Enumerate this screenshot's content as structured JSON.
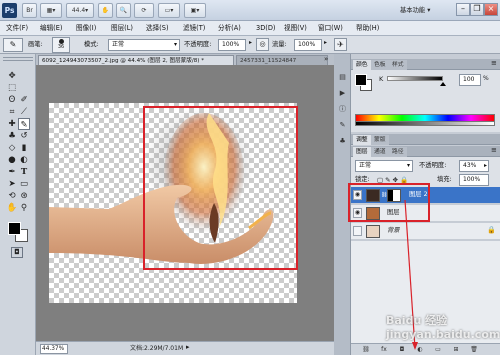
{
  "titlebar": {
    "logo": "Ps",
    "zoom_value": "44.4",
    "workspace": "基本功能",
    "workspace_arrow": "▾"
  },
  "menu": [
    "文件(F)",
    "编辑(E)",
    "图像(I)",
    "图层(L)",
    "选择(S)",
    "滤镜(T)",
    "分析(A)",
    "3D(D)",
    "视图(V)",
    "窗口(W)",
    "帮助(H)"
  ],
  "options": {
    "brush_label": "画笔:",
    "brush_size": "36",
    "mode_label": "模式:",
    "mode_value": "正常",
    "opacity_label": "不透明度:",
    "opacity_value": "100%",
    "flow_label": "流量:",
    "flow_value": "100%"
  },
  "tabs": [
    {
      "label": "6092_124943073507_2.jpg @ 44.4% (图层 2, 图层蒙版/8) *",
      "active": true
    },
    {
      "label": "2457331_11524847",
      "active": false
    }
  ],
  "statusbar": {
    "zoom": "44.37%",
    "doc": "文档:2.29M/7.01M"
  },
  "color_panel": {
    "tabs": [
      "颜色",
      "色板",
      "样式"
    ],
    "k_label": "K",
    "k_value": "100",
    "k_unit": "%",
    "foreground": "#000000"
  },
  "adjust_panel": {
    "tabs": [
      "调整",
      "蒙版"
    ]
  },
  "layers_panel": {
    "tabs": [
      "图层",
      "通道",
      "路径"
    ],
    "blend_mode": "正常",
    "opacity_label": "不透明度:",
    "opacity_value": "43%",
    "lock_label": "锁定:",
    "fill_label": "填充:",
    "fill_value": "100%",
    "layers": [
      {
        "name": "图层 2",
        "selected": true
      },
      {
        "name": "图层",
        "selected": false
      },
      {
        "name": "背景",
        "selected": false
      }
    ],
    "bottom_icons": [
      "link-icon",
      "fx-icon",
      "mask-icon",
      "adjustment-icon",
      "folder-icon",
      "new-layer-icon",
      "trash-icon"
    ]
  },
  "annotations": {
    "highlight_color": "#d9222a"
  },
  "watermark": "Baidu 经验 jingyan.baidu.com"
}
